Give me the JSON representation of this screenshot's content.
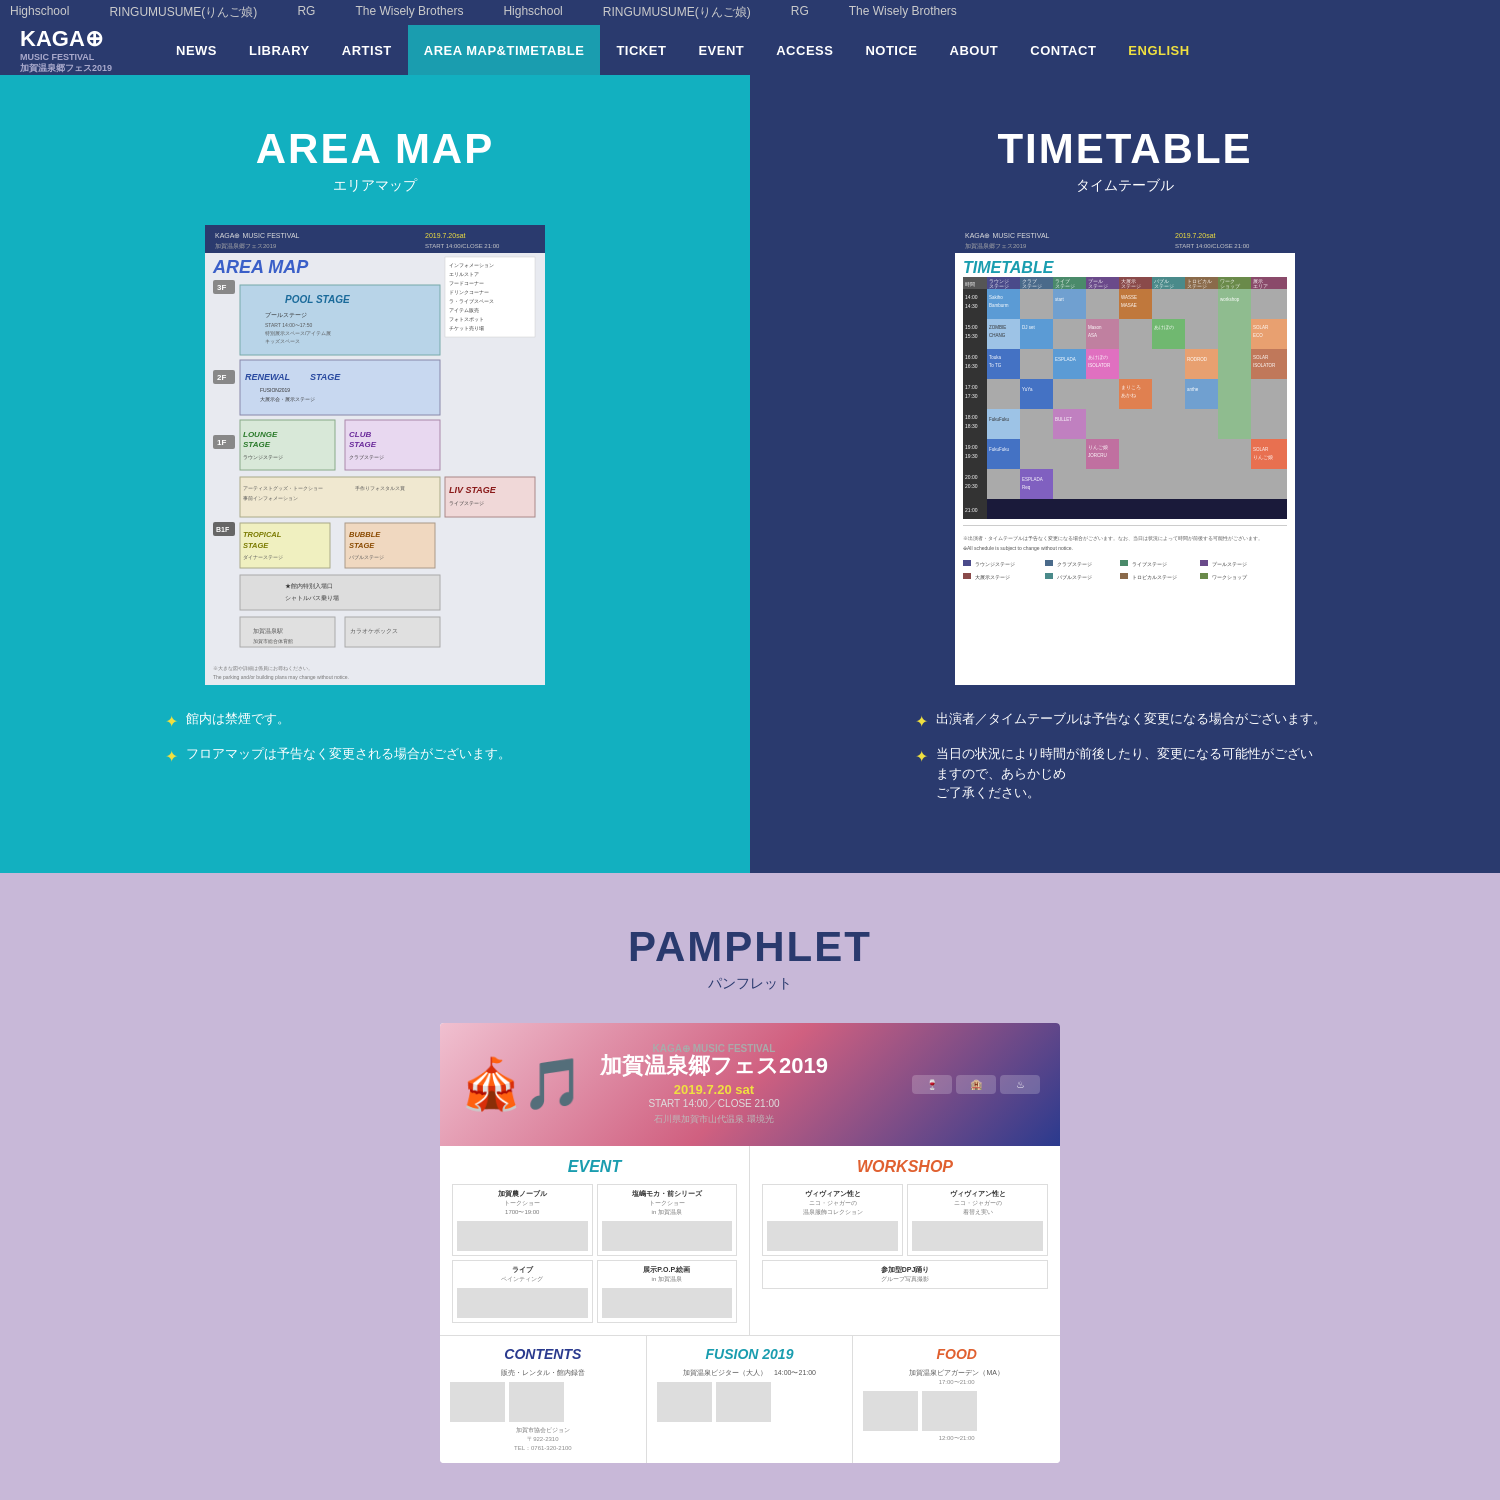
{
  "marquee": {
    "items": [
      "Highschool",
      "RINGUMUSUME(りんご娘)",
      "RG",
      "The Wisely Brothers"
    ]
  },
  "nav": {
    "logo_main": "KAGA⊕ MUSIC FESTIVAL",
    "logo_sub": "加賀温泉郷フェス2019",
    "items": [
      {
        "label": "NEWS",
        "active": false
      },
      {
        "label": "LIBRARY",
        "active": false
      },
      {
        "label": "ARTIST",
        "active": false
      },
      {
        "label": "AREA MAP&TIMETABLE",
        "active": true
      },
      {
        "label": "TICKET",
        "active": false
      },
      {
        "label": "EVENT",
        "active": false
      },
      {
        "label": "ACCESS",
        "active": false
      },
      {
        "label": "NOTICE",
        "active": false
      },
      {
        "label": "ABOUT",
        "active": false
      },
      {
        "label": "CONTACT",
        "active": false
      },
      {
        "label": "ENGLISH",
        "active": false,
        "highlight": true
      }
    ]
  },
  "area_map": {
    "title_en": "AREA MAP",
    "title_jp": "エリアマップ",
    "notes": [
      "館内は禁煙です。",
      "フロアマップは予告なく変更される場合がございます。"
    ]
  },
  "timetable": {
    "title_en": "TIMETABLE",
    "title_jp": "タイムテーブル",
    "notes": [
      "出演者／タイムテーブルは予告なく変更になる場合がございます。",
      "当日の状況により時間が前後したり、変更になる可能性がございますので、あらかじめご了承ください。"
    ]
  },
  "pamphlet": {
    "title_en": "PAMPHLET",
    "title_jp": "パンフレット",
    "date": "2019.7.20 sat",
    "start_close": "START 14:00／CLOSE 21:00",
    "venue": "石川県加賀市山代温泉 環境光",
    "sections": {
      "event": "EVENT",
      "workshop": "WORKSHOP",
      "contents": "CONTENTS",
      "fusion": "FUSION 2019",
      "food": "FOOD"
    }
  }
}
